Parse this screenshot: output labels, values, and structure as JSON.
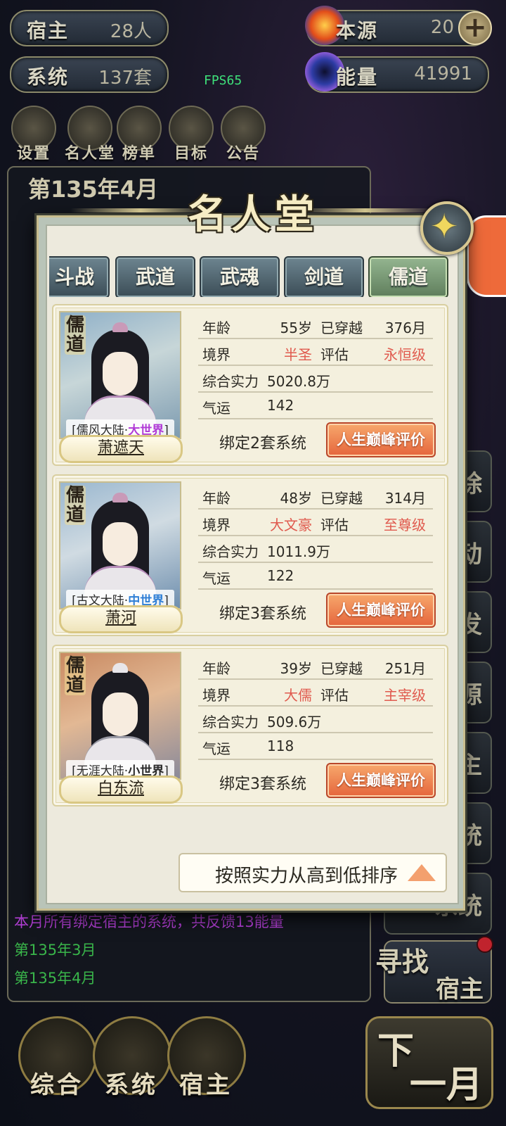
{
  "resources": {
    "hosts": {
      "label": "宿主",
      "value": "28人"
    },
    "systems": {
      "label": "系统",
      "value": "137套"
    },
    "origin": {
      "label": "本源",
      "value": "20"
    },
    "energy": {
      "label": "能量",
      "value": "41991"
    }
  },
  "fps": "FPS65",
  "shortcuts": [
    "设置",
    "名人堂",
    "榜单",
    "目标",
    "公告"
  ],
  "log": {
    "date_header": "第135年4月",
    "lines": [
      {
        "text": "本月所有绑定宿主的系统，共反馈13能量",
        "color": "#b33fd6"
      },
      {
        "text": "第135年3月",
        "color": "#39b54a"
      },
      {
        "text": "第135年4月",
        "color": "#39b54a"
      }
    ]
  },
  "right_buttons": [
    "除",
    "动",
    "发",
    "源",
    "主",
    "统"
  ],
  "right_system_label": "系统",
  "find_button": {
    "line1": "寻找",
    "line2": "宿主"
  },
  "bottom_nav": [
    "综合",
    "系统",
    "宿主"
  ],
  "next_month": {
    "line1": "下",
    "line2": "一月"
  },
  "modal": {
    "title": "名人堂",
    "tabs": [
      "斗战",
      "武道",
      "武魂",
      "剑道",
      "儒道"
    ],
    "active_tab": "儒道",
    "stat_labels": {
      "age": "年龄",
      "crossed": "已穿越",
      "realm": "境界",
      "rating": "评估",
      "power": "综合实力",
      "luck": "气运"
    },
    "peak_button": "人生巅峰评价",
    "sort_label": "按照实力从高到低排序",
    "heroes": [
      {
        "badge": "儒道",
        "name": "萧遮天",
        "world_name": "[儒风大陆·",
        "world_zone": "大世界",
        "world_close": "]",
        "zone_color": "#b03ad6",
        "age": "55岁",
        "crossed": "376月",
        "realm": "半圣",
        "rating": "永恒级",
        "power": "5020.8万",
        "luck": "142",
        "bind": "绑定2套系统"
      },
      {
        "badge": "儒道",
        "name": "萧河",
        "world_name": "[古文大陆·",
        "world_zone": "中世界",
        "world_close": "]",
        "zone_color": "#2f7fd6",
        "age": "48岁",
        "crossed": "314月",
        "realm": "大文豪",
        "rating": "至尊级",
        "power": "1011.9万",
        "luck": "122",
        "bind": "绑定3套系统"
      },
      {
        "badge": "儒道",
        "name": "白东流",
        "world_name": "[无涯大陆·",
        "world_zone": "小世界",
        "world_close": "]",
        "zone_color": "#2a2a2a",
        "age": "39岁",
        "crossed": "251月",
        "realm": "大儒",
        "rating": "主宰级",
        "power": "509.6万",
        "luck": "118",
        "bind": "绑定3套系统"
      }
    ]
  },
  "colors": {
    "accent_red": "#e05a4e",
    "peak_orange": "#e5653c",
    "active_tab_green": "#6f8f6a"
  }
}
